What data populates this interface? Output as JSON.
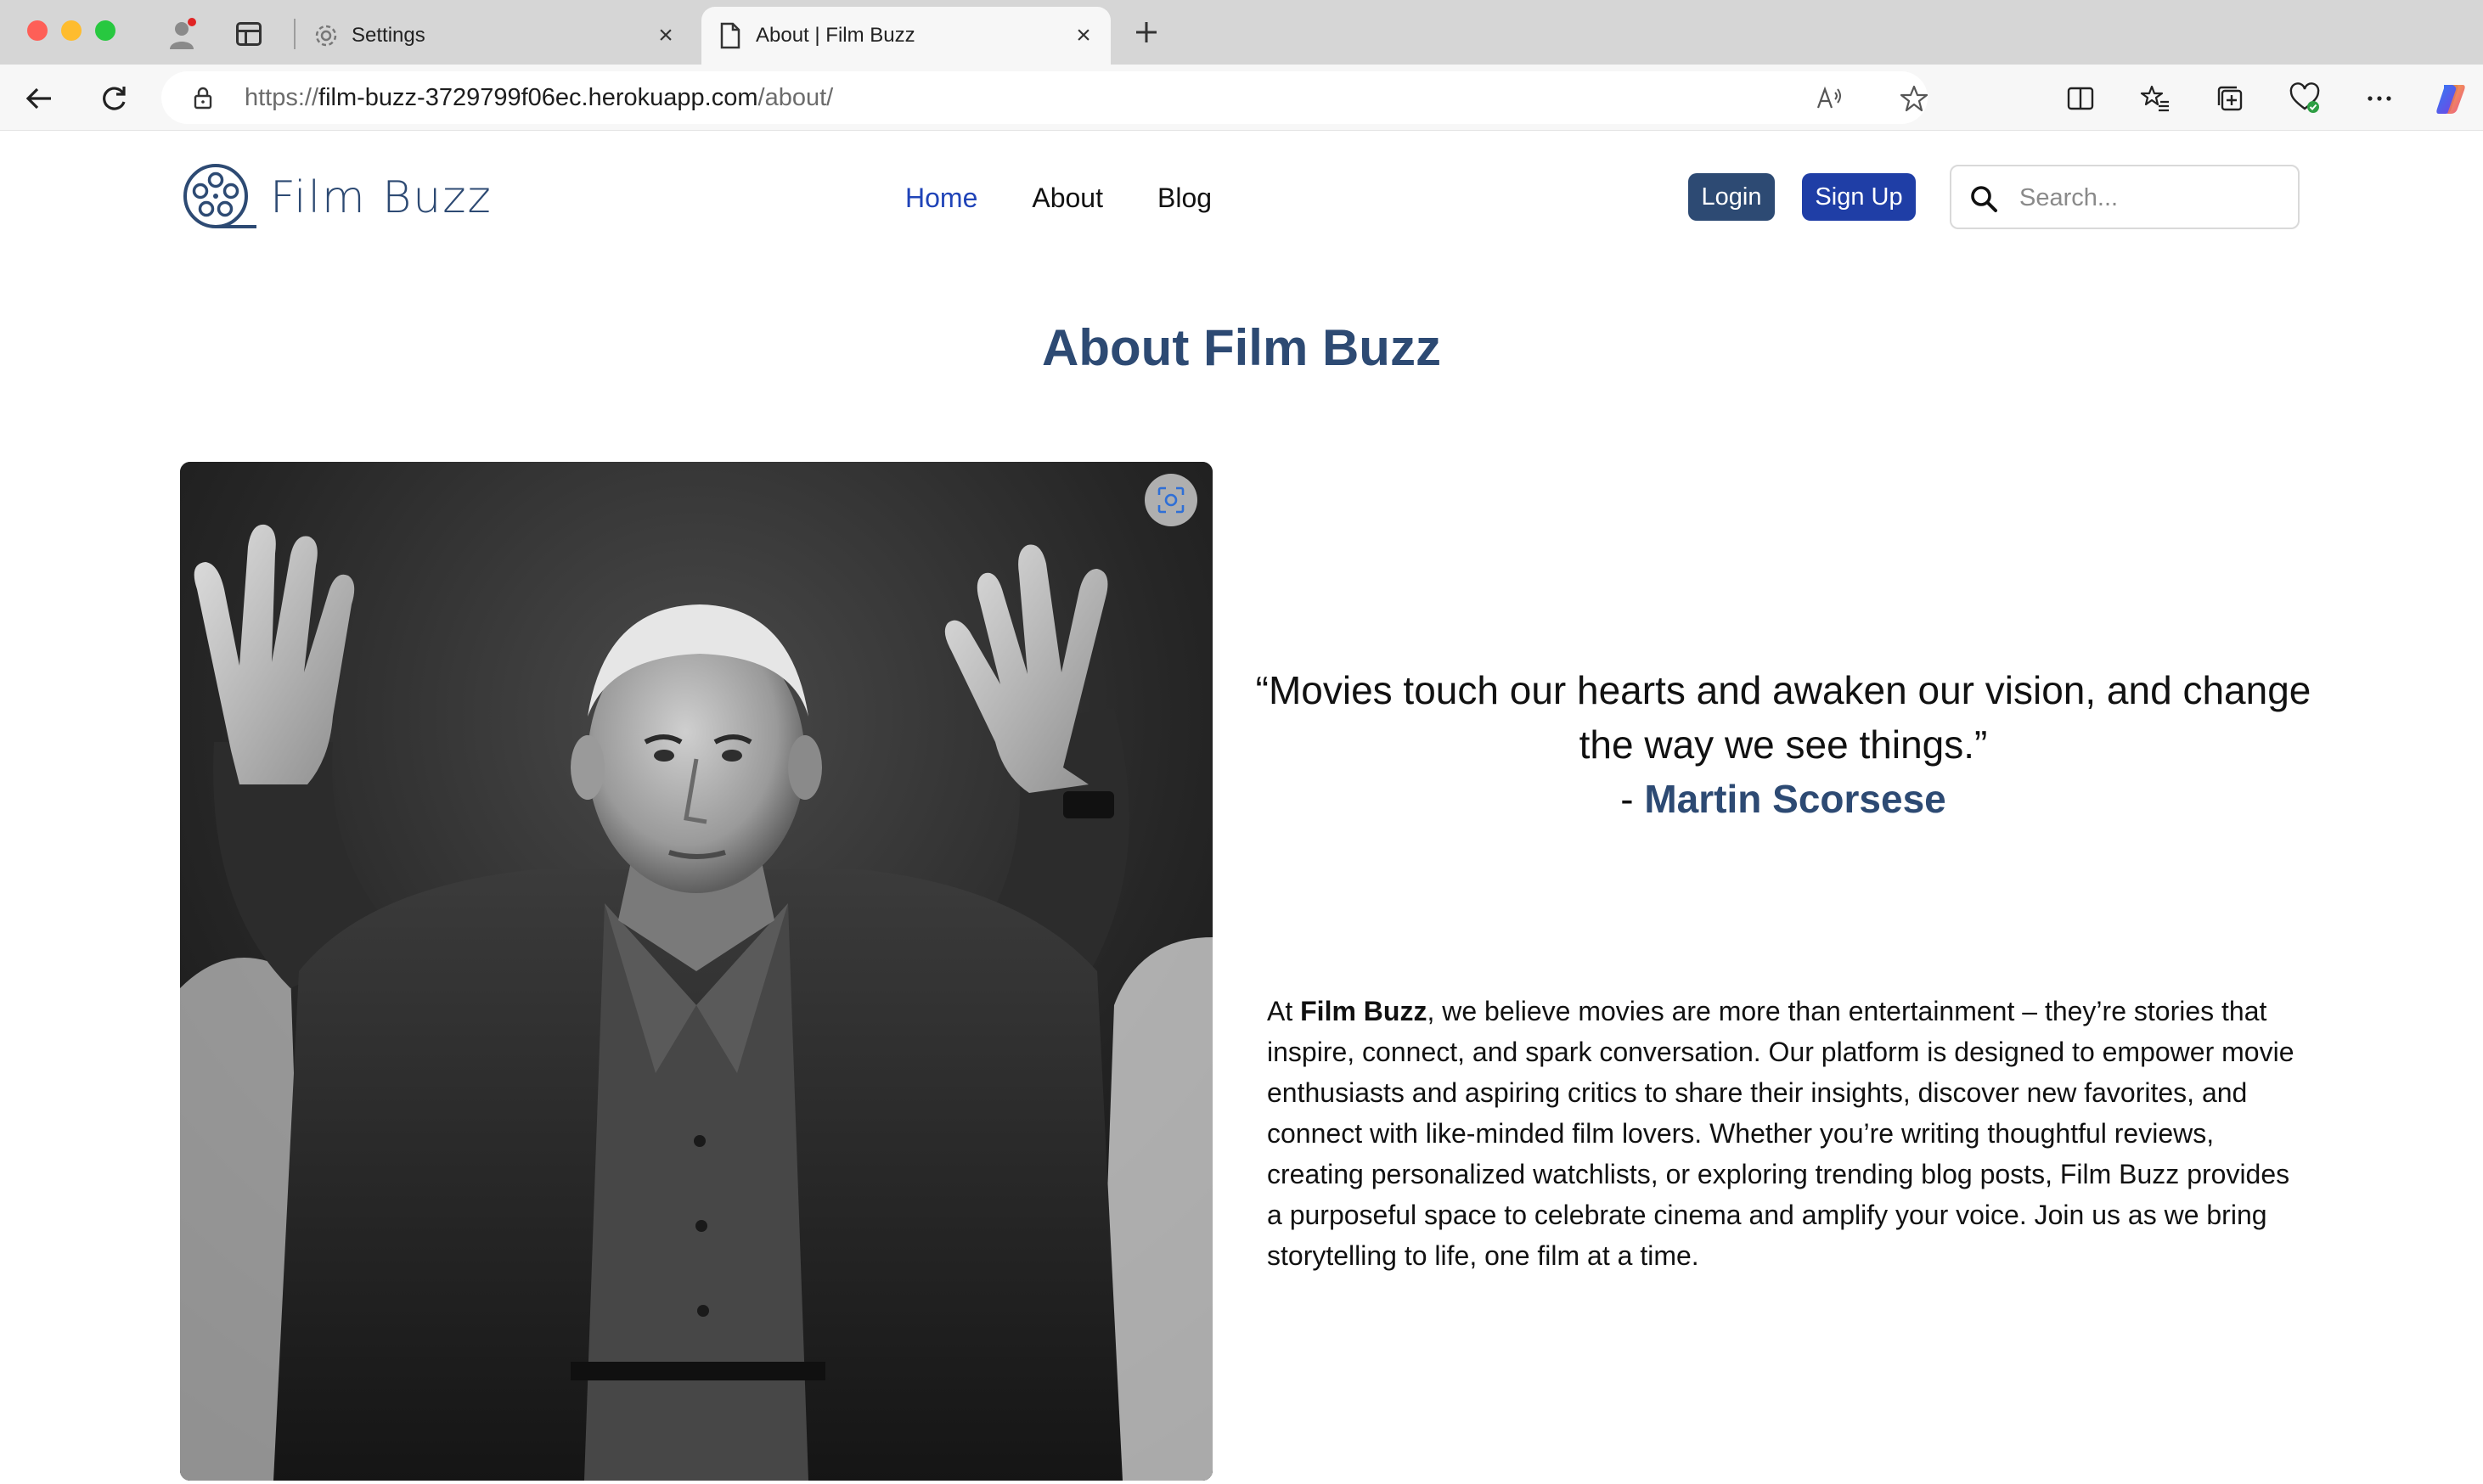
{
  "browser": {
    "tabs": [
      {
        "title": "Settings",
        "active": false
      },
      {
        "title": "About | Film Buzz",
        "active": true
      }
    ],
    "url": {
      "scheme": "https://",
      "host": "film-buzz-3729799f06ec.herokuapp.com",
      "path": "/about/"
    }
  },
  "site": {
    "brand": "Film Buzz",
    "nav": [
      {
        "label": "Home",
        "active": true
      },
      {
        "label": "About",
        "active": false
      },
      {
        "label": "Blog",
        "active": false
      }
    ],
    "login_label": "Login",
    "signup_label": "Sign Up",
    "search_placeholder": "Search..."
  },
  "about": {
    "heading": "About Film Buzz",
    "quote_line": "“Movies touch our hearts and awaken our vision, and change the way we see things.”",
    "quote_dash": "- ",
    "quote_author": "Martin Scorsese",
    "body_prefix": "At ",
    "body_brand": "Film Buzz",
    "body_rest": ", we believe movies are more than entertainment – they’re stories that inspire, connect, and spark conversation. Our platform is designed to empower movie enthusiasts and aspiring critics to share their insights, discover new favorites, and connect with like-minded film lovers. Whether you’re writing thoughtful reviews, creating personalized watchlists, or exploring trending blog posts, Film Buzz provides a purposeful space to celebrate cinema and amplify your voice. Join us as we bring storytelling to life, one film at a time."
  },
  "colors": {
    "brand_navy": "#2d4a73",
    "link_active": "#2044b8",
    "signup_blue": "#1f3ea6"
  }
}
